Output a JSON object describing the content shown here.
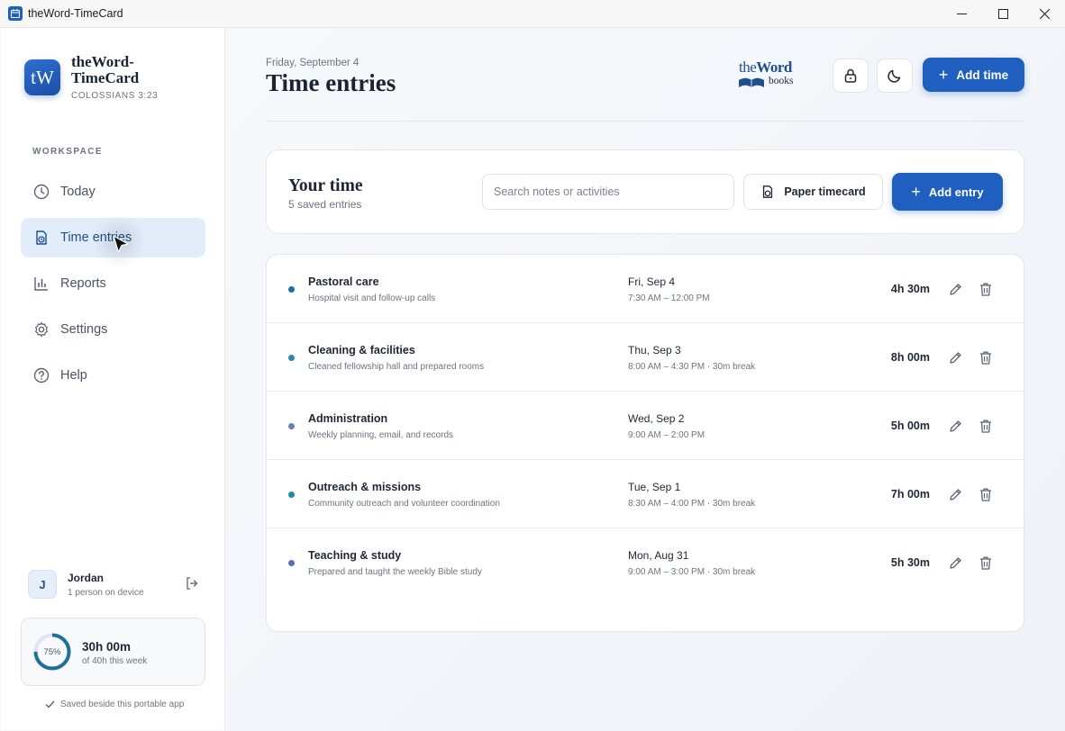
{
  "window": {
    "title": "theWord-TimeCard"
  },
  "brand": {
    "initials": "tW",
    "name": "theWord-TimeCard",
    "verse": "COLOSSIANS 3:23"
  },
  "sidebar": {
    "section_label": "WORKSPACE",
    "items": [
      {
        "label": "Today",
        "icon": "clock-icon",
        "active": false
      },
      {
        "label": "Time entries",
        "icon": "timecard-icon",
        "active": true
      },
      {
        "label": "Reports",
        "icon": "bar-chart-icon",
        "active": false
      },
      {
        "label": "Settings",
        "icon": "gear-icon",
        "active": false
      },
      {
        "label": "Help",
        "icon": "help-icon",
        "active": false
      }
    ]
  },
  "user": {
    "initial": "J",
    "name": "Jordan",
    "subtitle": "1 person on device"
  },
  "week": {
    "percent_label": "75%",
    "progress": 0.75,
    "hours": "30h 00m",
    "subtitle": "of 40h this week"
  },
  "saved_note": "Saved beside this portable app",
  "header": {
    "date": "Friday, September 4",
    "title": "Time entries",
    "logo": {
      "prefix": "the",
      "word": "Word",
      "sub": "books"
    },
    "add_time_label": "Add time"
  },
  "toolbar": {
    "heading": "Your time",
    "count": "5 saved entries",
    "search_placeholder": "Search notes or activities",
    "paper_timecard_label": "Paper timecard",
    "add_entry_label": "Add entry"
  },
  "entries": [
    {
      "activity": "Pastoral care",
      "note": "Hospital visit and follow-up calls",
      "day": "Fri, Sep 4",
      "range": "7:30 AM – 12:00 PM",
      "duration": "4h 30m",
      "color": "#1f6f9a"
    },
    {
      "activity": "Cleaning & facilities",
      "note": "Cleaned fellowship hall and prepared rooms",
      "day": "Thu, Sep 3",
      "range": "8:00 AM – 4:30 PM · 30m break",
      "duration": "8h 00m",
      "color": "#2f84b8"
    },
    {
      "activity": "Administration",
      "note": "Weekly planning, email, and records",
      "day": "Wed, Sep 2",
      "range": "9:00 AM – 2:00 PM",
      "duration": "5h 00m",
      "color": "#6b80b0"
    },
    {
      "activity": "Outreach & missions",
      "note": "Community outreach and volunteer coordination",
      "day": "Tue, Sep 1",
      "range": "8:30 AM – 4:00 PM · 30m break",
      "duration": "7h 00m",
      "color": "#1f8aa0"
    },
    {
      "activity": "Teaching & study",
      "note": "Prepared and taught the weekly Bible study",
      "day": "Mon, Aug 31",
      "range": "9:00 AM – 3:00 PM · 30m break",
      "duration": "5h 30m",
      "color": "#5a6fb0"
    }
  ],
  "colors": {
    "accent": "#1f5fbf",
    "nav_active_bg": "#e2edf9",
    "ring": "#1f6f9a"
  }
}
